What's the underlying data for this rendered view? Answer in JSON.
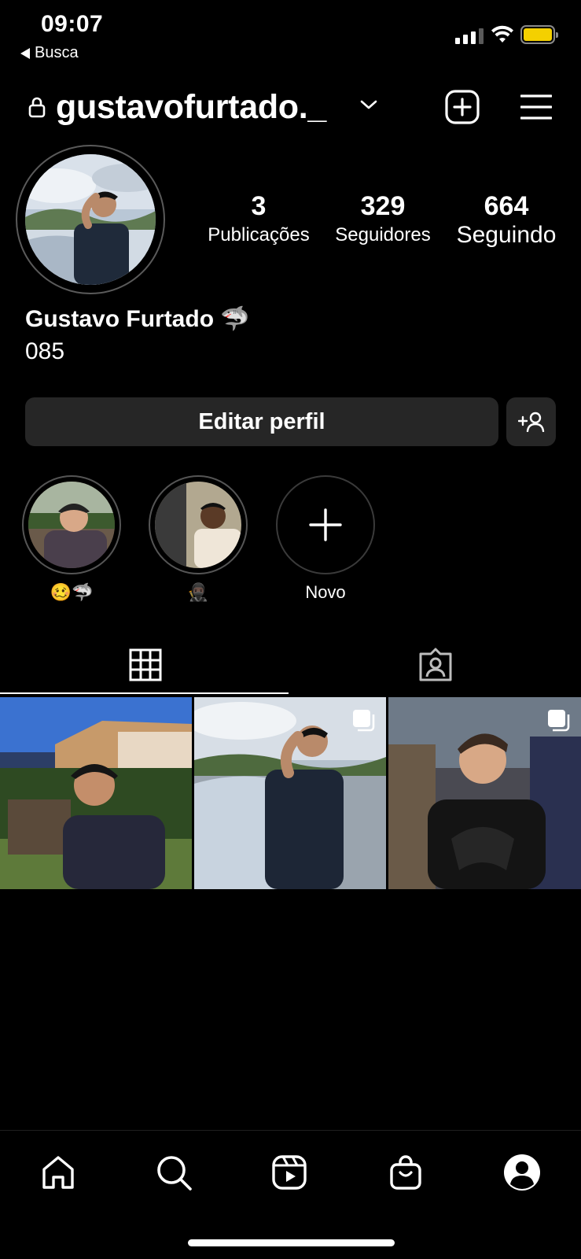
{
  "status_bar": {
    "time": "09:07",
    "back_label": "Busca",
    "battery_color": "#f4d000"
  },
  "header": {
    "username": "gustavofurtado._",
    "icons": [
      "lock-icon",
      "chevron-down-icon",
      "add-post-icon",
      "menu-icon"
    ]
  },
  "profile": {
    "stats": [
      {
        "value": "3",
        "label": "Publicações"
      },
      {
        "value": "329",
        "label": "Seguidores"
      },
      {
        "value": "664",
        "label": "Seguindo"
      }
    ],
    "full_name": "Gustavo Furtado",
    "name_emoji": "🦈",
    "bio": "085"
  },
  "actions": {
    "edit_label": "Editar perfil",
    "discover_icon": "add-person-icon"
  },
  "highlights": [
    {
      "caption": "🥴🦈"
    },
    {
      "caption": "🥷🏿"
    },
    {
      "caption": "Novo"
    }
  ],
  "tabs": {
    "active": "grid",
    "items": [
      "grid-icon",
      "tagged-icon"
    ]
  },
  "nav": {
    "items": [
      "home-icon",
      "search-icon",
      "reels-icon",
      "shop-icon",
      "profile-icon"
    ]
  }
}
